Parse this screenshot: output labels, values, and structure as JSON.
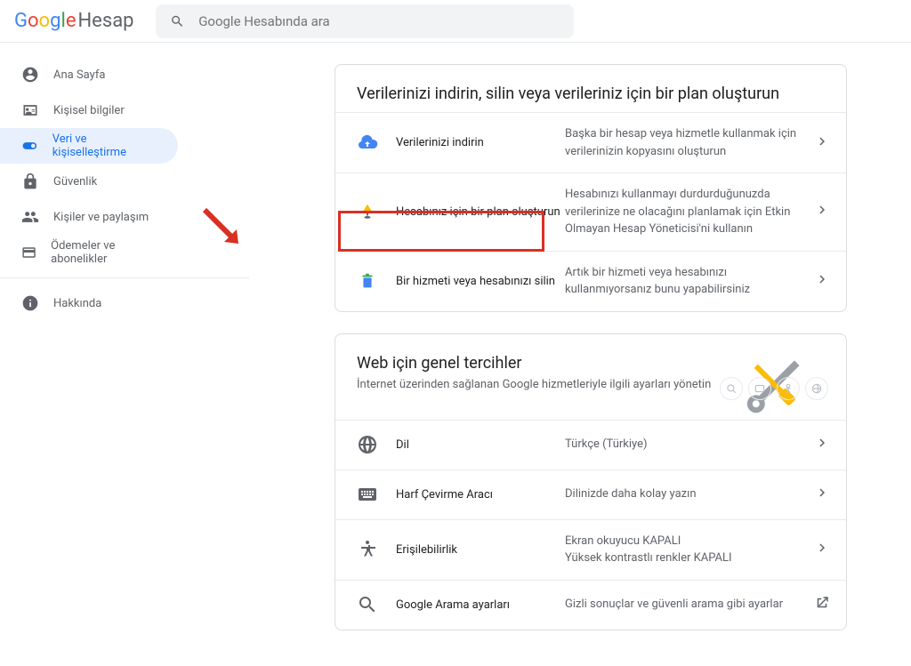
{
  "header": {
    "logo_suffix": "Hesap",
    "search_placeholder": "Google Hesabında ara"
  },
  "sidebar": {
    "items": [
      {
        "label": "Ana Sayfa"
      },
      {
        "label": "Kişisel bilgiler"
      },
      {
        "label": "Veri ve kişiselleştirme"
      },
      {
        "label": "Güvenlik"
      },
      {
        "label": "Kişiler ve paylaşım"
      },
      {
        "label": "Ödemeler ve abonelikler"
      }
    ],
    "about": "Hakkında"
  },
  "card1": {
    "title": "Verilerinizi indirin, silin veya verileriniz için bir plan oluşturun",
    "rows": [
      {
        "label": "Verilerinizi indirin",
        "desc": "Başka bir hesap veya hizmetle kullanmak için verilerinizin kopyasını oluşturun"
      },
      {
        "label": "Hesabınız için bir plan oluşturun",
        "desc": "Hesabınızı kullanmayı durdurduğunuzda verilerinize ne olacağını planlamak için Etkin Olmayan Hesap Yöneticisi'ni kullanın"
      },
      {
        "label": "Bir hizmeti veya hesabınızı silin",
        "desc": "Artık bir hizmeti veya hesabınızı kullanmıyorsanız bunu yapabilirsiniz"
      }
    ]
  },
  "card2": {
    "title": "Web için genel tercihler",
    "sub": "İnternet üzerinden sağlanan Google hizmetleriyle ilgili ayarları yönetin",
    "rows": [
      {
        "label": "Dil",
        "desc": "Türkçe (Türkiye)"
      },
      {
        "label": "Harf Çevirme Aracı",
        "desc": "Dilinizde daha kolay yazın"
      },
      {
        "label": "Erişilebilirlik",
        "desc": "Ekran okuyucu KAPALI\nYüksek kontrastlı renkler KAPALI"
      },
      {
        "label": "Google Arama ayarları",
        "desc": "Gizli sonuçlar ve güvenli arama gibi ayarlar"
      }
    ]
  }
}
